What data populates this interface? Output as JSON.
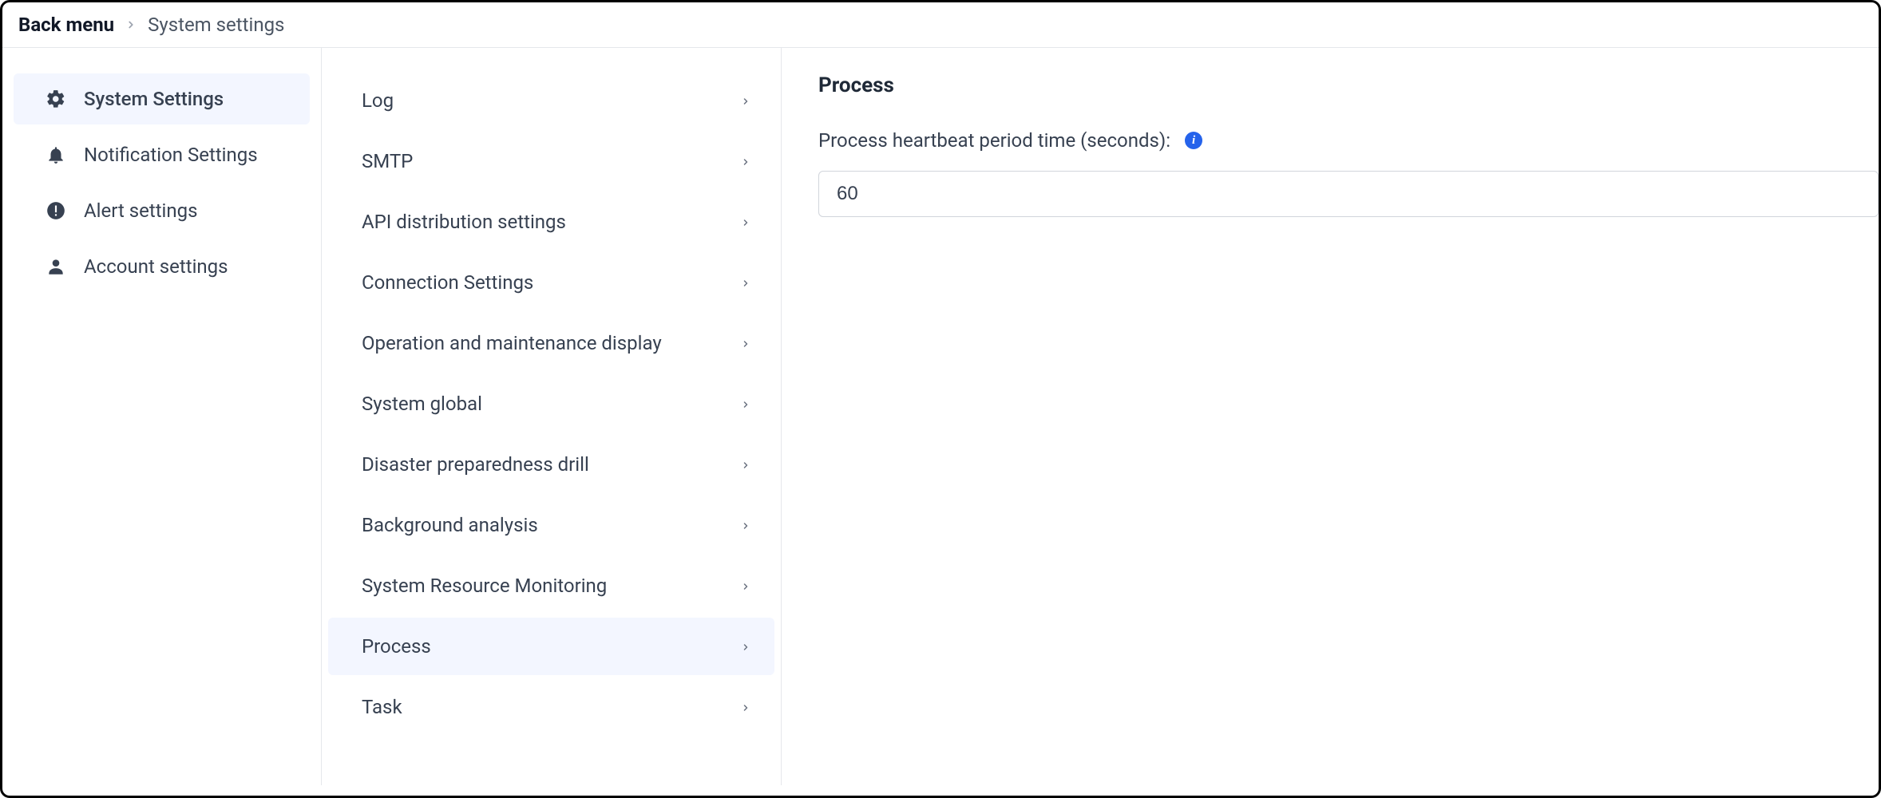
{
  "breadcrumb": {
    "back": "Back menu",
    "current": "System settings"
  },
  "sidebar": {
    "items": [
      {
        "id": "system-settings",
        "label": "System Settings",
        "icon": "gear",
        "active": true
      },
      {
        "id": "notification-settings",
        "label": "Notification Settings",
        "icon": "bell",
        "active": false
      },
      {
        "id": "alert-settings",
        "label": "Alert settings",
        "icon": "alert",
        "active": false
      },
      {
        "id": "account-settings",
        "label": "Account settings",
        "icon": "user",
        "active": false
      }
    ]
  },
  "submenu": {
    "items": [
      {
        "id": "log",
        "label": "Log",
        "active": false
      },
      {
        "id": "smtp",
        "label": "SMTP",
        "active": false
      },
      {
        "id": "api-distribution",
        "label": "API distribution settings",
        "active": false
      },
      {
        "id": "connection",
        "label": "Connection Settings",
        "active": false
      },
      {
        "id": "omd",
        "label": "Operation and maintenance display",
        "active": false
      },
      {
        "id": "system-global",
        "label": "System global",
        "active": false
      },
      {
        "id": "dpd",
        "label": "Disaster preparedness drill",
        "active": false
      },
      {
        "id": "bg-analysis",
        "label": "Background analysis",
        "active": false
      },
      {
        "id": "srm",
        "label": "System Resource Monitoring",
        "active": false
      },
      {
        "id": "process",
        "label": "Process",
        "active": true
      },
      {
        "id": "task",
        "label": "Task",
        "active": false
      }
    ]
  },
  "content": {
    "title": "Process",
    "heartbeat_label": "Process heartbeat period time (seconds):",
    "heartbeat_value": "60"
  }
}
